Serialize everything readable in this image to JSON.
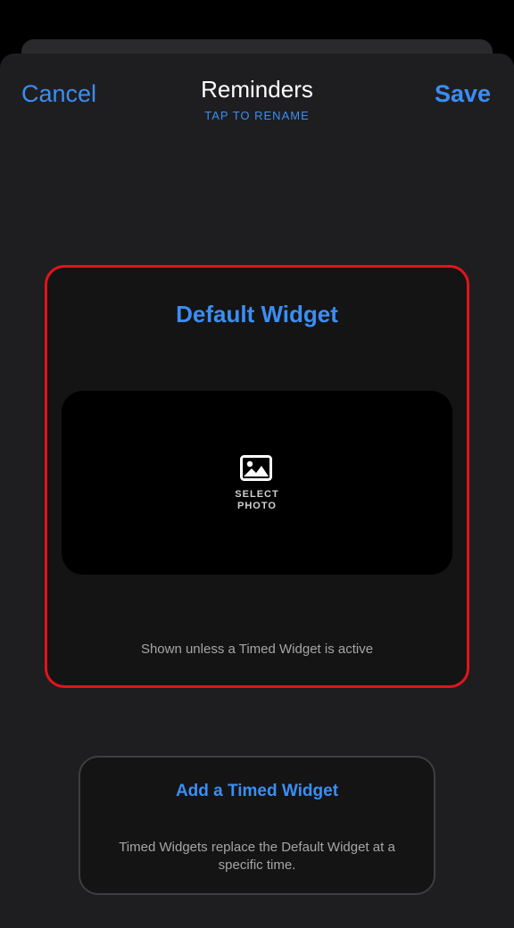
{
  "colors": {
    "accent": "#3a8ef5",
    "highlight_border": "#e2141c",
    "sheet_background": "#1e1e20",
    "card_background": "#141414",
    "secondary_text": "#a5a5a9"
  },
  "nav": {
    "cancel_label": "Cancel",
    "title": "Reminders",
    "subtitle": "TAP TO RENAME",
    "save_label": "Save"
  },
  "default_widget": {
    "title": "Default Widget",
    "select_photo_icon": "photo-icon",
    "select_photo_line1": "SELECT",
    "select_photo_line2": "PHOTO",
    "description": "Shown unless a Timed Widget is active"
  },
  "timed_widget": {
    "title": "Add a Timed Widget",
    "description": "Timed Widgets replace the Default Widget at a specific time."
  }
}
